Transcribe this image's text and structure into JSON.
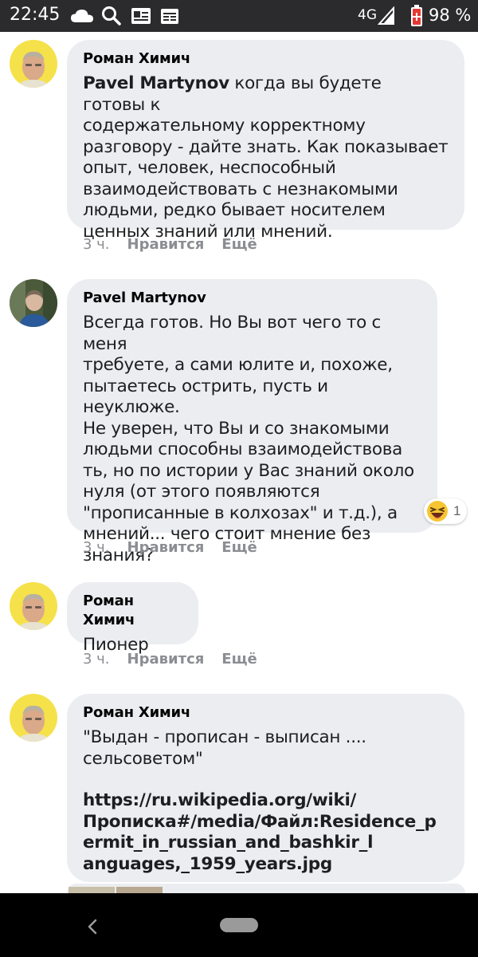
{
  "status_bar": {
    "time": "22:45",
    "network": "4G",
    "battery": "98 %"
  },
  "comments": [
    {
      "author": "Роман Химич",
      "mention": "Pavel Martynov",
      "text": "когда вы будете готовы к\nсодержательному корректному\nразговору - дайте знать. Как показывает\nопыт, человек, неспособный\nвзаимодействовать с незнакомыми\nлюдьми, редко бывает носителем\nценных знаний или мнений.",
      "time": "3 ч.",
      "like_label": "Нравится",
      "more_label": "Ещё"
    },
    {
      "author": "Pavel Martynov",
      "text": "Всегда готов. Но Вы вот чего то с меня\nтребуете, а сами юлите и, похоже,\nпытаетесь острить, пусть и неуклюже.\nНе уверен, что Вы и со знакомыми\nлюдьми способны взаимодействова\nть, но по истории у Вас знаний около\nнуля (от этого появляются\n\"прописанные в колхозах\" и т.д.), а\nмнений... чего стоит мнение без\nзнания?",
      "reaction_count": "1",
      "time": "3 ч.",
      "like_label": "Нравится",
      "more_label": "Ещё"
    },
    {
      "author": "Роман Химич",
      "text": "Пионер",
      "time": "3 ч.",
      "like_label": "Нравится",
      "more_label": "Ещё"
    },
    {
      "author": "Роман Химич",
      "text": "\"Выдан - прописан - выписан ....\nсельсоветом\"",
      "link": "https://ru.wikipedia.org/wiki/\nПрописка#/media/Файл:Residence_p\nermit_in_russian_and_bashkir_l\nanguages,_1959_years.jpg"
    }
  ]
}
